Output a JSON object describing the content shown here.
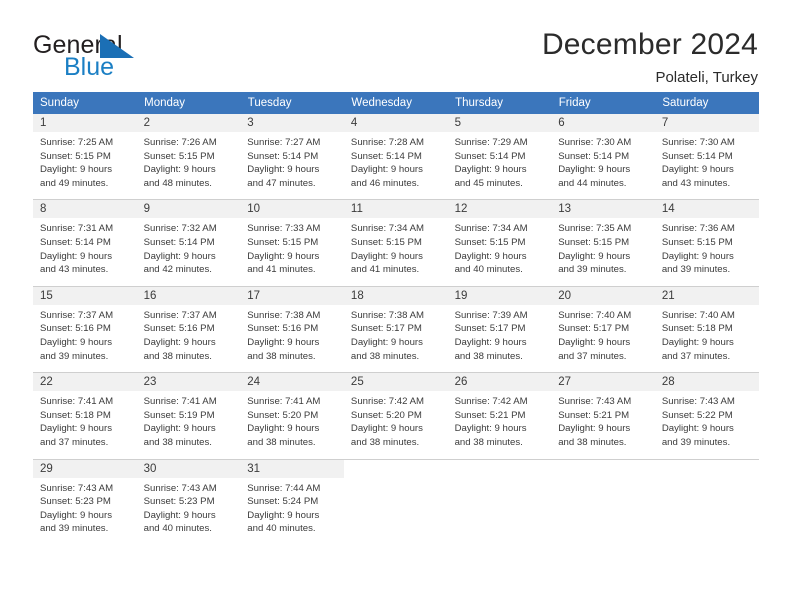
{
  "brand": {
    "name_part1": "General",
    "name_part2": "Blue",
    "mark": "triangle-logo"
  },
  "header": {
    "title": "December 2024",
    "location": "Polateli, Turkey"
  },
  "calendar": {
    "weekday_headers": [
      "Sunday",
      "Monday",
      "Tuesday",
      "Wednesday",
      "Thursday",
      "Friday",
      "Saturday"
    ],
    "header_color": "#3b76bc",
    "daynum_bg": "#f1f1f1",
    "weeks": [
      [
        {
          "day": "1",
          "sunrise": "Sunrise: 7:25 AM",
          "sunset": "Sunset: 5:15 PM",
          "daylight1": "Daylight: 9 hours",
          "daylight2": "and 49 minutes."
        },
        {
          "day": "2",
          "sunrise": "Sunrise: 7:26 AM",
          "sunset": "Sunset: 5:15 PM",
          "daylight1": "Daylight: 9 hours",
          "daylight2": "and 48 minutes."
        },
        {
          "day": "3",
          "sunrise": "Sunrise: 7:27 AM",
          "sunset": "Sunset: 5:14 PM",
          "daylight1": "Daylight: 9 hours",
          "daylight2": "and 47 minutes."
        },
        {
          "day": "4",
          "sunrise": "Sunrise: 7:28 AM",
          "sunset": "Sunset: 5:14 PM",
          "daylight1": "Daylight: 9 hours",
          "daylight2": "and 46 minutes."
        },
        {
          "day": "5",
          "sunrise": "Sunrise: 7:29 AM",
          "sunset": "Sunset: 5:14 PM",
          "daylight1": "Daylight: 9 hours",
          "daylight2": "and 45 minutes."
        },
        {
          "day": "6",
          "sunrise": "Sunrise: 7:30 AM",
          "sunset": "Sunset: 5:14 PM",
          "daylight1": "Daylight: 9 hours",
          "daylight2": "and 44 minutes."
        },
        {
          "day": "7",
          "sunrise": "Sunrise: 7:30 AM",
          "sunset": "Sunset: 5:14 PM",
          "daylight1": "Daylight: 9 hours",
          "daylight2": "and 43 minutes."
        }
      ],
      [
        {
          "day": "8",
          "sunrise": "Sunrise: 7:31 AM",
          "sunset": "Sunset: 5:14 PM",
          "daylight1": "Daylight: 9 hours",
          "daylight2": "and 43 minutes."
        },
        {
          "day": "9",
          "sunrise": "Sunrise: 7:32 AM",
          "sunset": "Sunset: 5:14 PM",
          "daylight1": "Daylight: 9 hours",
          "daylight2": "and 42 minutes."
        },
        {
          "day": "10",
          "sunrise": "Sunrise: 7:33 AM",
          "sunset": "Sunset: 5:15 PM",
          "daylight1": "Daylight: 9 hours",
          "daylight2": "and 41 minutes."
        },
        {
          "day": "11",
          "sunrise": "Sunrise: 7:34 AM",
          "sunset": "Sunset: 5:15 PM",
          "daylight1": "Daylight: 9 hours",
          "daylight2": "and 41 minutes."
        },
        {
          "day": "12",
          "sunrise": "Sunrise: 7:34 AM",
          "sunset": "Sunset: 5:15 PM",
          "daylight1": "Daylight: 9 hours",
          "daylight2": "and 40 minutes."
        },
        {
          "day": "13",
          "sunrise": "Sunrise: 7:35 AM",
          "sunset": "Sunset: 5:15 PM",
          "daylight1": "Daylight: 9 hours",
          "daylight2": "and 39 minutes."
        },
        {
          "day": "14",
          "sunrise": "Sunrise: 7:36 AM",
          "sunset": "Sunset: 5:15 PM",
          "daylight1": "Daylight: 9 hours",
          "daylight2": "and 39 minutes."
        }
      ],
      [
        {
          "day": "15",
          "sunrise": "Sunrise: 7:37 AM",
          "sunset": "Sunset: 5:16 PM",
          "daylight1": "Daylight: 9 hours",
          "daylight2": "and 39 minutes."
        },
        {
          "day": "16",
          "sunrise": "Sunrise: 7:37 AM",
          "sunset": "Sunset: 5:16 PM",
          "daylight1": "Daylight: 9 hours",
          "daylight2": "and 38 minutes."
        },
        {
          "day": "17",
          "sunrise": "Sunrise: 7:38 AM",
          "sunset": "Sunset: 5:16 PM",
          "daylight1": "Daylight: 9 hours",
          "daylight2": "and 38 minutes."
        },
        {
          "day": "18",
          "sunrise": "Sunrise: 7:38 AM",
          "sunset": "Sunset: 5:17 PM",
          "daylight1": "Daylight: 9 hours",
          "daylight2": "and 38 minutes."
        },
        {
          "day": "19",
          "sunrise": "Sunrise: 7:39 AM",
          "sunset": "Sunset: 5:17 PM",
          "daylight1": "Daylight: 9 hours",
          "daylight2": "and 38 minutes."
        },
        {
          "day": "20",
          "sunrise": "Sunrise: 7:40 AM",
          "sunset": "Sunset: 5:17 PM",
          "daylight1": "Daylight: 9 hours",
          "daylight2": "and 37 minutes."
        },
        {
          "day": "21",
          "sunrise": "Sunrise: 7:40 AM",
          "sunset": "Sunset: 5:18 PM",
          "daylight1": "Daylight: 9 hours",
          "daylight2": "and 37 minutes."
        }
      ],
      [
        {
          "day": "22",
          "sunrise": "Sunrise: 7:41 AM",
          "sunset": "Sunset: 5:18 PM",
          "daylight1": "Daylight: 9 hours",
          "daylight2": "and 37 minutes."
        },
        {
          "day": "23",
          "sunrise": "Sunrise: 7:41 AM",
          "sunset": "Sunset: 5:19 PM",
          "daylight1": "Daylight: 9 hours",
          "daylight2": "and 38 minutes."
        },
        {
          "day": "24",
          "sunrise": "Sunrise: 7:41 AM",
          "sunset": "Sunset: 5:20 PM",
          "daylight1": "Daylight: 9 hours",
          "daylight2": "and 38 minutes."
        },
        {
          "day": "25",
          "sunrise": "Sunrise: 7:42 AM",
          "sunset": "Sunset: 5:20 PM",
          "daylight1": "Daylight: 9 hours",
          "daylight2": "and 38 minutes."
        },
        {
          "day": "26",
          "sunrise": "Sunrise: 7:42 AM",
          "sunset": "Sunset: 5:21 PM",
          "daylight1": "Daylight: 9 hours",
          "daylight2": "and 38 minutes."
        },
        {
          "day": "27",
          "sunrise": "Sunrise: 7:43 AM",
          "sunset": "Sunset: 5:21 PM",
          "daylight1": "Daylight: 9 hours",
          "daylight2": "and 38 minutes."
        },
        {
          "day": "28",
          "sunrise": "Sunrise: 7:43 AM",
          "sunset": "Sunset: 5:22 PM",
          "daylight1": "Daylight: 9 hours",
          "daylight2": "and 39 minutes."
        }
      ],
      [
        {
          "day": "29",
          "sunrise": "Sunrise: 7:43 AM",
          "sunset": "Sunset: 5:23 PM",
          "daylight1": "Daylight: 9 hours",
          "daylight2": "and 39 minutes."
        },
        {
          "day": "30",
          "sunrise": "Sunrise: 7:43 AM",
          "sunset": "Sunset: 5:23 PM",
          "daylight1": "Daylight: 9 hours",
          "daylight2": "and 40 minutes."
        },
        {
          "day": "31",
          "sunrise": "Sunrise: 7:44 AM",
          "sunset": "Sunset: 5:24 PM",
          "daylight1": "Daylight: 9 hours",
          "daylight2": "and 40 minutes."
        },
        {
          "day": "",
          "sunrise": "",
          "sunset": "",
          "daylight1": "",
          "daylight2": ""
        },
        {
          "day": "",
          "sunrise": "",
          "sunset": "",
          "daylight1": "",
          "daylight2": ""
        },
        {
          "day": "",
          "sunrise": "",
          "sunset": "",
          "daylight1": "",
          "daylight2": ""
        },
        {
          "day": "",
          "sunrise": "",
          "sunset": "",
          "daylight1": "",
          "daylight2": ""
        }
      ]
    ]
  }
}
